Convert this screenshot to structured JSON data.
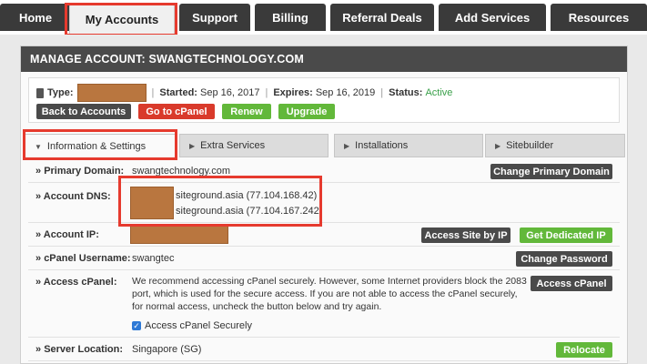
{
  "nav": {
    "home": "Home",
    "my_accounts": "My Accounts",
    "support": "Support",
    "billing": "Billing",
    "referral": "Referral Deals",
    "add_services": "Add Services",
    "resources": "Resources"
  },
  "panel": {
    "title": "MANAGE ACCOUNT: SWANGTECHNOLOGY.COM"
  },
  "info": {
    "type_label": "Type:",
    "started_label": "Started:",
    "started_value": "Sep 16, 2017",
    "expires_label": "Expires:",
    "expires_value": "Sep 16, 2019",
    "status_label": "Status:",
    "status_value": "Active",
    "status_color": "#3aa04a"
  },
  "actions": {
    "back": "Back to Accounts",
    "cpanel": "Go to cPanel",
    "renew": "Renew",
    "upgrade": "Upgrade"
  },
  "subtabs": {
    "info": "Information & Settings",
    "extra": "Extra Services",
    "installations": "Installations",
    "sitebuilder": "Sitebuilder"
  },
  "rows": {
    "primary_domain": {
      "label": "Primary Domain:",
      "value": "swangtechnology.com",
      "button": "Change Primary Domain"
    },
    "dns": {
      "label": "Account DNS:",
      "ns1": "siteground.asia (77.104.168.42)",
      "ns2": "siteground.asia (77.104.167.242)"
    },
    "ip": {
      "label": "Account IP:",
      "button1": "Access Site by IP",
      "button2": "Get Dedicated IP"
    },
    "cpanel_user": {
      "label": "cPanel Username:",
      "value": "swangtec",
      "button": "Change Password"
    },
    "access_cpanel": {
      "label": "Access cPanel:",
      "text1": "We recommend accessing cPanel securely. However, some Internet providers block the 2083",
      "text2": "port, which is used for the secure access. If you are not able to access the cPanel securely,",
      "text3": "for normal access, uncheck the button below and try again.",
      "checkbox": "Access cPanel Securely",
      "button": "Access cPanel"
    },
    "location": {
      "label": "Server Location:",
      "value": "Singapore (SG)",
      "button": "Relocate"
    }
  },
  "colors": {
    "accent_red": "#e63a2e",
    "green": "#62b83a",
    "dark": "#4a4a4a"
  }
}
